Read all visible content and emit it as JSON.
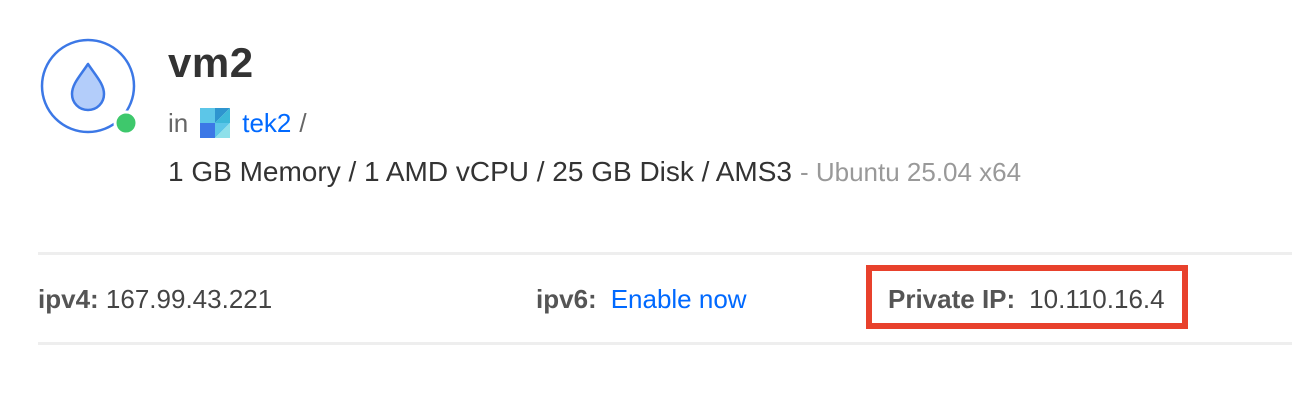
{
  "droplet": {
    "name": "vm2",
    "status": "online",
    "status_color": "#3ec86c",
    "icon": "droplet-icon",
    "in_label": "in",
    "project_icon": "project-icon",
    "project_name": "tek2",
    "project_separator": "/",
    "specs": "1 GB Memory / 1 AMD vCPU / 25 GB Disk / AMS3",
    "os": "- Ubuntu 25.04 x64"
  },
  "network": {
    "ipv4_label": "ipv4:",
    "ipv4_value": "167.99.43.221",
    "ipv6_label": "ipv6:",
    "ipv6_link": "Enable now",
    "private_label": "Private IP:",
    "private_value": "10.110.16.4"
  },
  "colors": {
    "accent": "#0069ff",
    "highlight_box": "#e8412c"
  }
}
